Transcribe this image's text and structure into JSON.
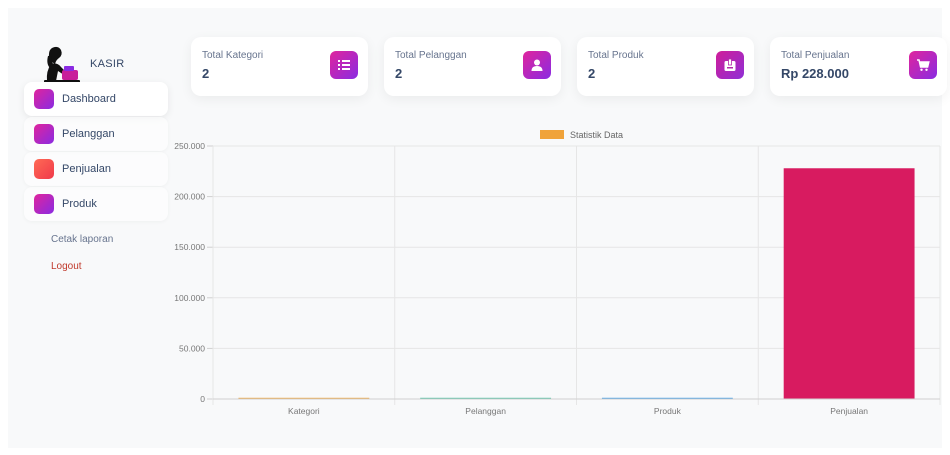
{
  "sidebar": {
    "brand": "KASIR",
    "items": [
      {
        "label": "Dashboard",
        "color": "#c81e9a"
      },
      {
        "label": "Pelanggan",
        "color": "#c81e9a"
      },
      {
        "label": "Penjualan",
        "color": "#f0394a"
      },
      {
        "label": "Produk",
        "color": "#c81e9a"
      }
    ],
    "report_link": "Cetak laporan",
    "logout_link": "Logout"
  },
  "cards": [
    {
      "title": "Total Kategori",
      "value": "2",
      "icon": "list-icon"
    },
    {
      "title": "Total Pelanggan",
      "value": "2",
      "icon": "user-icon"
    },
    {
      "title": "Total Produk",
      "value": "2",
      "icon": "box-icon"
    },
    {
      "title": "Total Penjualan",
      "value": "Rp 228.000",
      "icon": "cart-icon"
    }
  ],
  "chart_data": {
    "type": "bar",
    "legend": "Statistik Data",
    "legend_position": "top",
    "categories": [
      "Kategori",
      "Pelanggan",
      "Produk",
      "Penjualan"
    ],
    "values": [
      2,
      2,
      2,
      228000
    ],
    "bar_colors": [
      "#f0a33a",
      "#4bc0a0",
      "#3d9be9",
      "#d81b60"
    ],
    "legend_color": "#f0a33a",
    "y_ticks": [
      "0",
      "50.000",
      "100.000",
      "150.000",
      "200.000",
      "250.000"
    ],
    "ylim": [
      0,
      250000
    ],
    "grid": true
  }
}
